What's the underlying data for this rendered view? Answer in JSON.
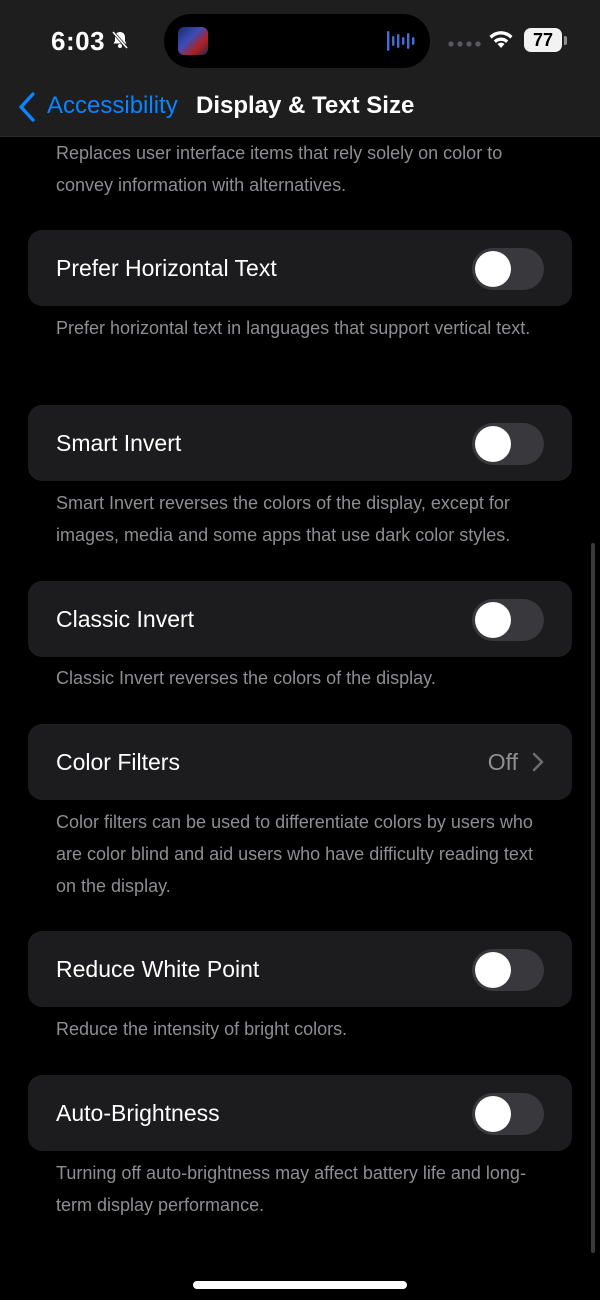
{
  "status": {
    "time": "6:03",
    "battery": "77",
    "icons": [
      "bell-slash-icon",
      "wifi-icon",
      "battery-icon",
      "signal-dots-icon"
    ]
  },
  "nav": {
    "back_label": "Accessibility",
    "title": "Display & Text Size",
    "accent_color": "#0a84ff"
  },
  "sections": {
    "differentiate_footer": "Replaces user interface items that rely solely on color to convey information with alternatives.",
    "prefer_horizontal": {
      "label": "Prefer Horizontal Text",
      "footer": "Prefer horizontal text in languages that support vertical text.",
      "on": false
    },
    "smart_invert": {
      "label": "Smart Invert",
      "footer": "Smart Invert reverses the colors of the display, except for images, media and some apps that use dark color styles.",
      "on": false
    },
    "classic_invert": {
      "label": "Classic Invert",
      "footer": "Classic Invert reverses the colors of the display.",
      "on": false
    },
    "color_filters": {
      "label": "Color Filters",
      "value": "Off",
      "footer": "Color filters can be used to differentiate colors by users who are color blind and aid users who have difficulty reading text on the display."
    },
    "reduce_white_point": {
      "label": "Reduce White Point",
      "footer": "Reduce the intensity of bright colors.",
      "on": false
    },
    "auto_brightness": {
      "label": "Auto-Brightness",
      "footer": "Turning off auto-brightness may affect battery life and long-term display performance.",
      "on": false
    }
  }
}
